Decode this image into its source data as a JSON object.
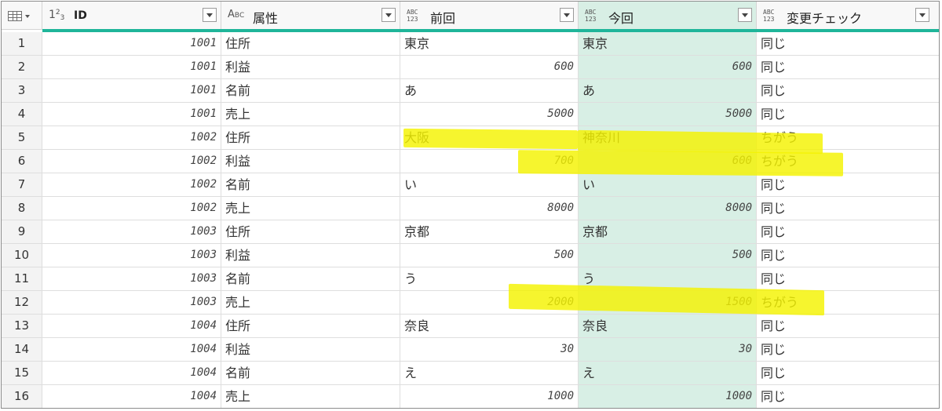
{
  "columns": [
    {
      "type": "123",
      "label": "ID"
    },
    {
      "type": "ABC",
      "label": "属性"
    },
    {
      "type": "ABC123",
      "label": "前回"
    },
    {
      "type": "ABC123",
      "label": "今回"
    },
    {
      "type": "ABC123",
      "label": "変更チェック"
    }
  ],
  "type_icons": {
    "num_a": "1",
    "num_b": "2",
    "num_c": "3",
    "abc_a": "A",
    "abc_b": "B",
    "abc_c": "C",
    "any_top": "ABC",
    "any_bottom": "123"
  },
  "rows": [
    {
      "n": "1",
      "id": "1001",
      "attr": "住所",
      "prev": "東京",
      "curr": "東京",
      "check": "同じ"
    },
    {
      "n": "2",
      "id": "1001",
      "attr": "利益",
      "prev": "600",
      "curr": "600",
      "check": "同じ"
    },
    {
      "n": "3",
      "id": "1001",
      "attr": "名前",
      "prev": "あ",
      "curr": "あ",
      "check": "同じ"
    },
    {
      "n": "4",
      "id": "1001",
      "attr": "売上",
      "prev": "5000",
      "curr": "5000",
      "check": "同じ"
    },
    {
      "n": "5",
      "id": "1002",
      "attr": "住所",
      "prev": "大阪",
      "curr": "神奈川",
      "check": "ちがう"
    },
    {
      "n": "6",
      "id": "1002",
      "attr": "利益",
      "prev": "700",
      "curr": "600",
      "check": "ちがう"
    },
    {
      "n": "7",
      "id": "1002",
      "attr": "名前",
      "prev": "い",
      "curr": "い",
      "check": "同じ"
    },
    {
      "n": "8",
      "id": "1002",
      "attr": "売上",
      "prev": "8000",
      "curr": "8000",
      "check": "同じ"
    },
    {
      "n": "9",
      "id": "1003",
      "attr": "住所",
      "prev": "京都",
      "curr": "京都",
      "check": "同じ"
    },
    {
      "n": "10",
      "id": "1003",
      "attr": "利益",
      "prev": "500",
      "curr": "500",
      "check": "同じ"
    },
    {
      "n": "11",
      "id": "1003",
      "attr": "名前",
      "prev": "う",
      "curr": "う",
      "check": "同じ"
    },
    {
      "n": "12",
      "id": "1003",
      "attr": "売上",
      "prev": "2000",
      "curr": "1500",
      "check": "ちがう"
    },
    {
      "n": "13",
      "id": "1004",
      "attr": "住所",
      "prev": "奈良",
      "curr": "奈良",
      "check": "同じ"
    },
    {
      "n": "14",
      "id": "1004",
      "attr": "利益",
      "prev": "30",
      "curr": "30",
      "check": "同じ"
    },
    {
      "n": "15",
      "id": "1004",
      "attr": "名前",
      "prev": "え",
      "curr": "え",
      "check": "同じ"
    },
    {
      "n": "16",
      "id": "1004",
      "attr": "売上",
      "prev": "1000",
      "curr": "1000",
      "check": "同じ"
    }
  ],
  "numeric_rows": [
    "2",
    "4",
    "6",
    "8",
    "10",
    "12",
    "14",
    "16"
  ],
  "colors": {
    "selected_column": "#d8efe5",
    "quality_bar": "#1fb59a",
    "highlighter": "#f4f300"
  },
  "icons": {
    "table_menu": "table-icon",
    "filter": "chevron-down-icon"
  }
}
